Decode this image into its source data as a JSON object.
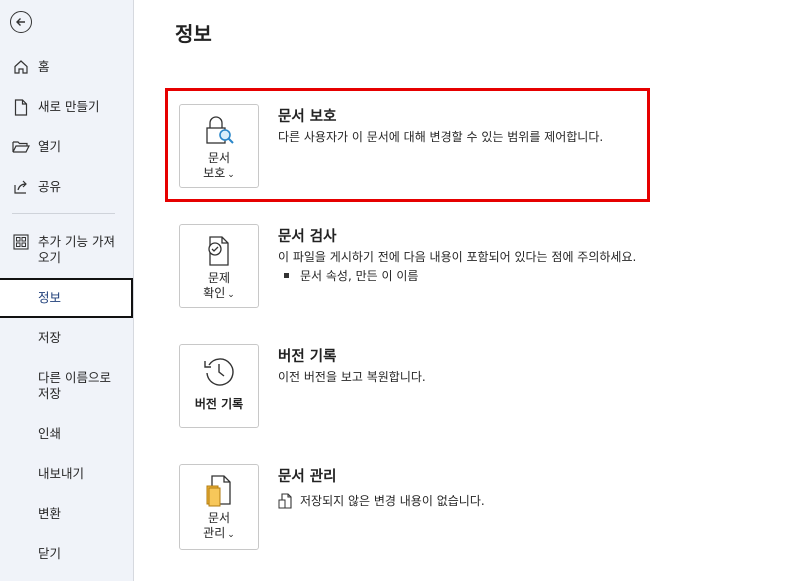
{
  "sidebar": {
    "back_icon": "back-arrow-icon",
    "items": [
      {
        "label": "홈",
        "icon": "home-icon"
      },
      {
        "label": "새로 만들기",
        "icon": "new-document-icon"
      },
      {
        "label": "열기",
        "icon": "open-folder-icon"
      },
      {
        "label": "공유",
        "icon": "share-icon"
      },
      {
        "label": "추가 기능 가져오기",
        "icon": "addins-icon"
      },
      {
        "label": "정보",
        "selected": true
      },
      {
        "label": "저장"
      },
      {
        "label": "다른 이름으로 저장"
      },
      {
        "label": "인쇄"
      },
      {
        "label": "내보내기"
      },
      {
        "label": "변환"
      },
      {
        "label": "닫기"
      }
    ]
  },
  "main": {
    "title": "정보",
    "sections": [
      {
        "tile_label_1": "문서",
        "tile_label_2": "보호",
        "tile_icon": "lock-search-icon",
        "title": "문서 보호",
        "description": "다른 사용자가 이 문서에 대해 변경할 수 있는 범위를 제어합니다.",
        "highlighted": true
      },
      {
        "tile_label_1": "문제",
        "tile_label_2": "확인",
        "tile_icon": "inspect-document-icon",
        "title": "문서 검사",
        "description": "이 파일을 게시하기 전에 다음 내용이 포함되어 있다는 점에 주의하세요.",
        "bullets": [
          "문서 속성, 만든 이 이름"
        ]
      },
      {
        "tile_label_1": "버전 기록",
        "tile_icon": "version-history-icon",
        "title": "버전 기록",
        "description": "이전 버전을 보고 복원합니다."
      },
      {
        "tile_label_1": "문서",
        "tile_label_2": "관리",
        "tile_icon": "manage-document-icon",
        "title": "문서 관리",
        "description": "저장되지 않은 변경 내용이 없습니다.",
        "description_icon": "document-icon"
      }
    ]
  },
  "colors": {
    "sidebar_bg": "#f0f3f9",
    "highlight": "#e60000"
  }
}
